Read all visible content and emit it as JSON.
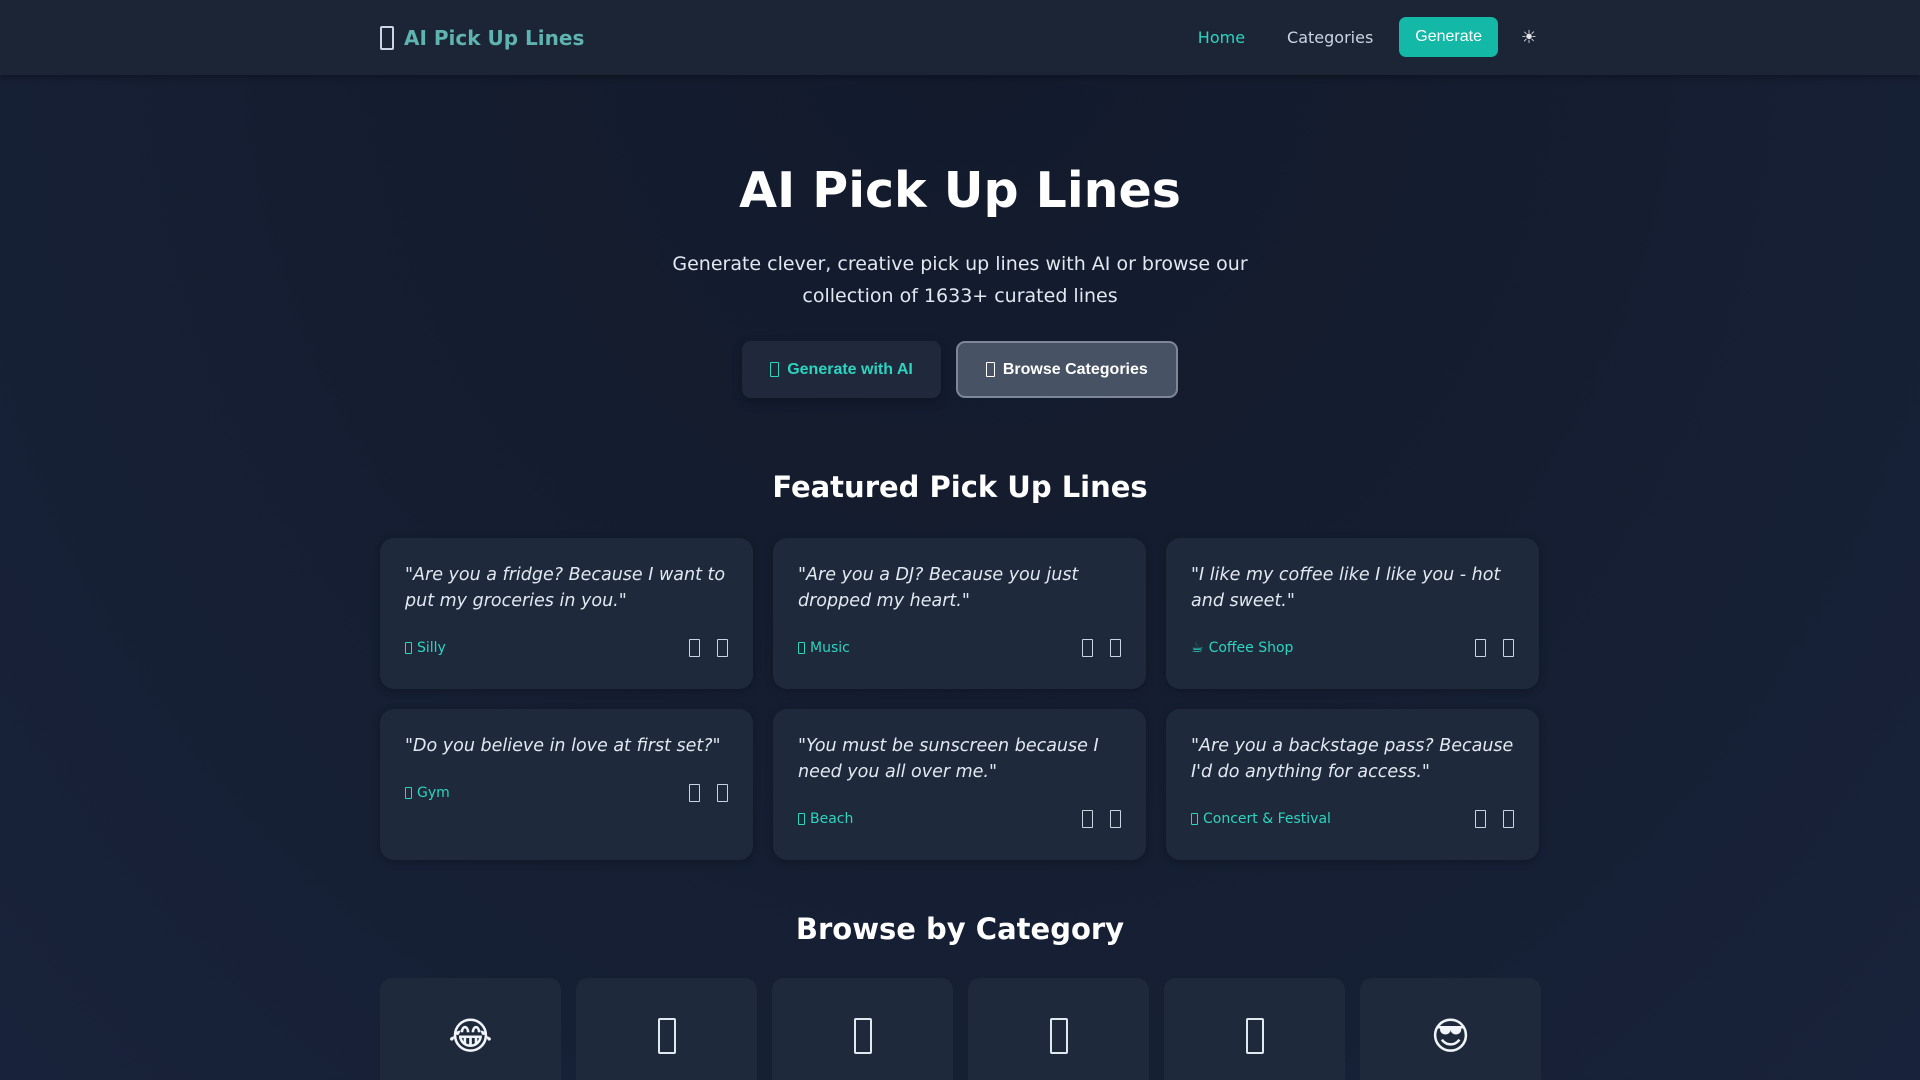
{
  "header": {
    "brand": "AI Pick Up Lines",
    "brand_icon": "tofu-icon",
    "nav": {
      "home": "Home",
      "categories": "Categories",
      "generate": "Generate"
    },
    "theme_toggle": "☀",
    "accent": "#2dd4bf"
  },
  "hero": {
    "title": "AI Pick Up Lines",
    "subtitle": "Generate clever, creative pick up lines with AI or browse our collection of 1633+ curated lines",
    "primary_button": "Generate with AI",
    "secondary_button": "Browse Categories"
  },
  "featured": {
    "title": "Featured Pick Up Lines",
    "cards": [
      {
        "quote": "\"Are you a fridge? Because I want to put my groceries in you.\"",
        "category": "Silly",
        "category_icon": "tofu-icon"
      },
      {
        "quote": "\"Are you a DJ? Because you just dropped my heart.\"",
        "category": "Music",
        "category_icon": "tofu-icon"
      },
      {
        "quote": "\"I like my coffee like I like you - hot and sweet.\"",
        "category": "Coffee Shop",
        "category_icon": "☕"
      },
      {
        "quote": "\"Do you believe in love at first set?\"",
        "category": "Gym",
        "category_icon": "tofu-icon"
      },
      {
        "quote": "\"You must be sunscreen because I need you all over me.\"",
        "category": "Beach",
        "category_icon": "tofu-icon"
      },
      {
        "quote": "\"Are you a backstage pass? Because I'd do anything for access.\"",
        "category": "Concert & Festival",
        "category_icon": "tofu-icon"
      }
    ]
  },
  "browse": {
    "title": "Browse by Category",
    "tiles": [
      {
        "icon": "😂"
      },
      {
        "icon": "tofu-icon"
      },
      {
        "icon": "tofu-icon"
      },
      {
        "icon": "tofu-icon"
      },
      {
        "icon": "tofu-icon"
      },
      {
        "icon": "😎"
      }
    ]
  }
}
